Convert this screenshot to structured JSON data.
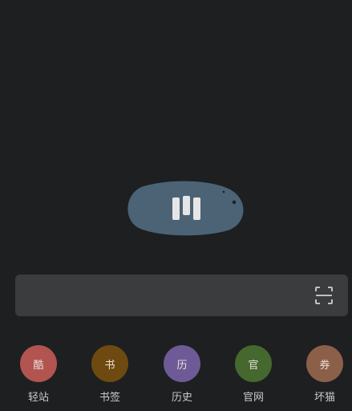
{
  "search": {
    "value": "",
    "placeholder": ""
  },
  "icons": {
    "logo": "app-logo-icon",
    "scan": "scan-icon"
  },
  "shortcuts": [
    {
      "glyph": "酷",
      "label": "轻站",
      "color": "#b2544f"
    },
    {
      "glyph": "书",
      "label": "书签",
      "color": "#6e4a10"
    },
    {
      "glyph": "历",
      "label": "历史",
      "color": "#6e5a96"
    },
    {
      "glyph": "官",
      "label": "官网",
      "color": "#44682e"
    },
    {
      "glyph": "券",
      "label": "坏猫",
      "color": "#8c5f48"
    }
  ]
}
